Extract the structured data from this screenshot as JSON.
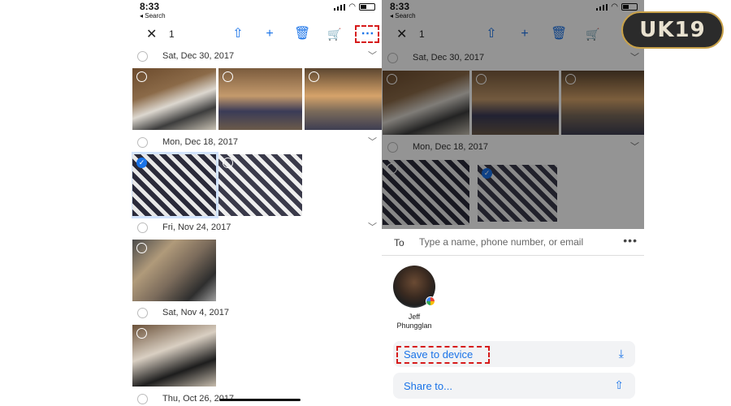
{
  "left_phone": {
    "status": {
      "time": "8:33",
      "back_label": "◂ Search"
    },
    "toolbar": {
      "close": "✕",
      "count": "1",
      "icons": [
        "share-icon",
        "add-icon",
        "trash-icon",
        "cart-icon",
        "more-icon"
      ]
    },
    "sections": [
      {
        "date": "Sat, Dec 30, 2017"
      },
      {
        "date": "Mon, Dec 18, 2017"
      },
      {
        "date": "Fri, Nov 24, 2017"
      },
      {
        "date": "Sat, Nov 4, 2017"
      },
      {
        "date": "Thu, Oct 26, 2017"
      }
    ]
  },
  "right_phone": {
    "status": {
      "time": "8:33",
      "back_label": "◂ Search"
    },
    "toolbar": {
      "close": "✕",
      "count": "1"
    },
    "sections": [
      {
        "date": "Sat, Dec 30, 2017"
      },
      {
        "date": "Mon, Dec 18, 2017"
      }
    ],
    "share_sheet": {
      "to_label": "To",
      "to_placeholder": "Type a name, phone number, or email",
      "contact_name": "Jeff\nPhungglan",
      "actions": [
        {
          "label": "Save to device",
          "icon": "download-icon"
        },
        {
          "label": "Share to...",
          "icon": "share-icon"
        }
      ]
    }
  },
  "logo": {
    "text": "UK19"
  },
  "colors": {
    "accent": "#1a73e8",
    "highlight": "#d61a1a",
    "logo_bg": "#2b2b2b",
    "logo_border": "#c9a24a"
  }
}
